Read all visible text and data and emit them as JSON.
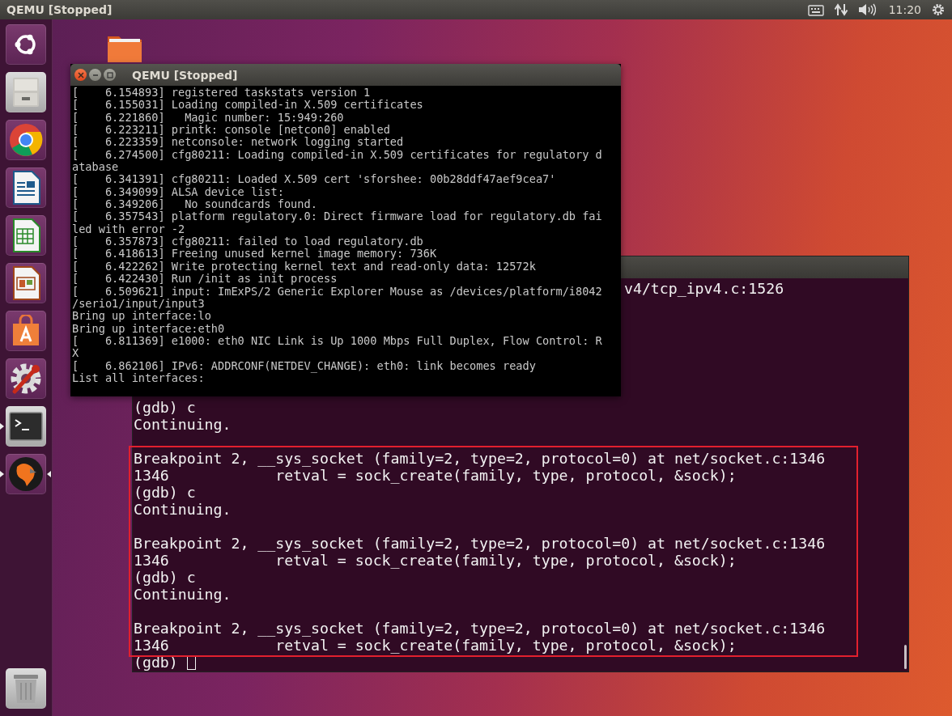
{
  "top_bar": {
    "title": "QEMU [Stopped]",
    "clock": "11:20"
  },
  "launcher": {
    "items": [
      {
        "running": false,
        "focused": false
      },
      {
        "running": false,
        "focused": false
      },
      {
        "running": false,
        "focused": false
      },
      {
        "running": false,
        "focused": false
      },
      {
        "running": false,
        "focused": false
      },
      {
        "running": false,
        "focused": false
      },
      {
        "running": false,
        "focused": false
      },
      {
        "running": false,
        "focused": false
      },
      {
        "running": true,
        "focused": false
      },
      {
        "running": true,
        "focused": true
      },
      {
        "running": false,
        "focused": false
      }
    ]
  },
  "qemu_window": {
    "title": "QEMU [Stopped]",
    "lines": [
      "[    6.154893] registered taskstats version 1",
      "[    6.155031] Loading compiled-in X.509 certificates",
      "[    6.221860]   Magic number: 15:949:260",
      "[    6.223211] printk: console [netcon0] enabled",
      "[    6.223359] netconsole: network logging started",
      "[    6.274500] cfg80211: Loading compiled-in X.509 certificates for regulatory d",
      "atabase",
      "[    6.341391] cfg80211: Loaded X.509 cert 'sforshee: 00b28ddf47aef9cea7'",
      "[    6.349099] ALSA device list:",
      "[    6.349206]   No soundcards found.",
      "[    6.357543] platform regulatory.0: Direct firmware load for regulatory.db fai",
      "led with error -2",
      "[    6.357873] cfg80211: failed to load regulatory.db",
      "[    6.418613] Freeing unused kernel image memory: 736K",
      "[    6.422262] Write protecting kernel text and read-only data: 12572k",
      "[    6.422430] Run /init as init process",
      "[    6.509621] input: ImExPS/2 Generic Explorer Mouse as /devices/platform/i8042",
      "/serio1/input/input3",
      "Bring up interface:lo",
      "Bring up interface:eth0",
      "[    6.811369] e1000: eth0 NIC Link is Up 1000 Mbps Full Duplex, Flow Control: R",
      "X",
      "[    6.862106] IPv6: ADDRCONF(NETDEV_CHANGE): eth0: link becomes ready",
      "List all interfaces:"
    ]
  },
  "terminal": {
    "cursor": true,
    "lines": [
      {
        "kind": "clipped",
        "text": "v4/tcp_ipv4.c:1526"
      },
      {
        "kind": "output",
        "text": "(gdb) c"
      },
      {
        "kind": "output",
        "text": "Continuing."
      },
      {
        "kind": "blank"
      },
      {
        "kind": "output",
        "text": "Breakpoint 2, __sys_socket (family=2, type=2, protocol=0) at net/socket.c:1346"
      },
      {
        "kind": "output",
        "text": "1346            retval = sock_create(family, type, protocol, &sock);"
      },
      {
        "kind": "output",
        "text": "(gdb) c"
      },
      {
        "kind": "output",
        "text": "Continuing."
      },
      {
        "kind": "blank"
      },
      {
        "kind": "output",
        "text": "Breakpoint 2, __sys_socket (family=2, type=2, protocol=0) at net/socket.c:1346"
      },
      {
        "kind": "output",
        "text": "1346            retval = sock_create(family, type, protocol, &sock);"
      },
      {
        "kind": "output",
        "text": "(gdb) c"
      },
      {
        "kind": "output",
        "text": "Continuing."
      },
      {
        "kind": "blank"
      },
      {
        "kind": "output",
        "text": "Breakpoint 2, __sys_socket (family=2, type=2, protocol=0) at net/socket.c:1346"
      },
      {
        "kind": "output",
        "text": "1346            retval = sock_create(family, type, protocol, &sock);"
      },
      {
        "kind": "input",
        "text": "(gdb)"
      }
    ]
  }
}
